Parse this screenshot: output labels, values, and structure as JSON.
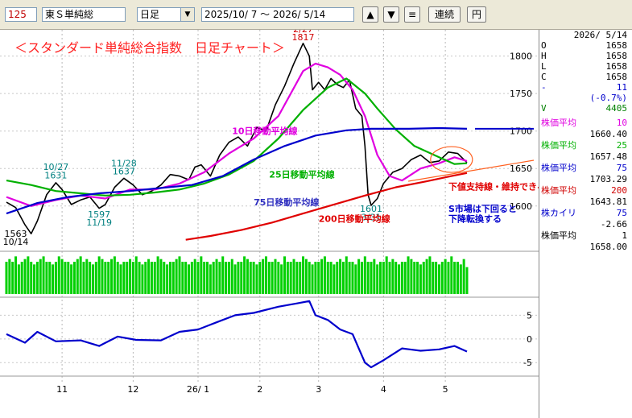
{
  "toolbar": {
    "code": "125",
    "name": "東Ｓ単純総",
    "period": "日足",
    "range": "2025/10/ 7 〜  2026/ 5/14",
    "up_icon": "triangle-up-icon",
    "down_icon": "triangle-down-icon",
    "menu_icon": "menu-icon",
    "continuous_label": "連続",
    "yen_label": "円"
  },
  "panel": {
    "date": "2026/ 5/14",
    "ohlc": [
      {
        "label": "O",
        "value": "1658"
      },
      {
        "label": "H",
        "value": "1658"
      },
      {
        "label": "L",
        "value": "1658"
      },
      {
        "label": "C",
        "value": "1658"
      }
    ],
    "change": {
      "label": "-",
      "value": "11"
    },
    "change_pct": "(-0.7%)",
    "volume": {
      "label": "V",
      "value": "4405"
    },
    "indicators": [
      {
        "label": "株価平均",
        "param": "10",
        "value": "1660.40",
        "color": "#e000e0"
      },
      {
        "label": "株価平均",
        "param": "25",
        "value": "1657.48",
        "color": "#00b000"
      },
      {
        "label": "株価平均",
        "param": "75",
        "value": "1703.29",
        "color": "#0000cc"
      },
      {
        "label": "株価平均",
        "param": "200",
        "value": "1643.81",
        "color": "#d00000"
      },
      {
        "label": "株カイリ",
        "param": "75",
        "value": "-2.66",
        "color": "#0000cc"
      },
      {
        "label": "株価平均",
        "param": "1",
        "value": "1658.00",
        "color": "#000000"
      }
    ]
  },
  "chart_data": {
    "type": "line",
    "title": "＜スタンダード単純総合指数　日足チャート＞",
    "x_ticks": [
      "11",
      "12",
      "26/ 1",
      "2",
      "3",
      "4",
      "5"
    ],
    "y_ticks": [
      1600,
      1650,
      1700,
      1750,
      1800
    ],
    "ylim": [
      1545,
      1835
    ],
    "dev_ticks": [
      5,
      0,
      -5
    ],
    "dev_lim": [
      -7,
      10
    ],
    "n_days": 150,
    "series": [
      {
        "name": "",
        "color": "#000000",
        "points": [
          [
            0,
            1605
          ],
          [
            3,
            1598
          ],
          [
            6,
            1575
          ],
          [
            8,
            1563
          ],
          [
            10,
            1580
          ],
          [
            13,
            1615
          ],
          [
            16,
            1631
          ],
          [
            18,
            1622
          ],
          [
            21,
            1602
          ],
          [
            24,
            1608
          ],
          [
            27,
            1612
          ],
          [
            30,
            1597
          ],
          [
            32,
            1602
          ],
          [
            35,
            1625
          ],
          [
            38,
            1637
          ],
          [
            41,
            1628
          ],
          [
            44,
            1615
          ],
          [
            47,
            1620
          ],
          [
            50,
            1628
          ],
          [
            53,
            1642
          ],
          [
            56,
            1640
          ],
          [
            59,
            1635
          ],
          [
            61,
            1652
          ],
          [
            63,
            1655
          ],
          [
            66,
            1640
          ],
          [
            69,
            1668
          ],
          [
            72,
            1685
          ],
          [
            75,
            1692
          ],
          [
            78,
            1680
          ],
          [
            81,
            1705
          ],
          [
            84,
            1700
          ],
          [
            87,
            1735
          ],
          [
            90,
            1760
          ],
          [
            93,
            1790
          ],
          [
            96,
            1817
          ],
          [
            98,
            1800
          ],
          [
            99,
            1755
          ],
          [
            101,
            1765
          ],
          [
            103,
            1755
          ],
          [
            105,
            1770
          ],
          [
            107,
            1762
          ],
          [
            109,
            1758
          ],
          [
            111,
            1768
          ],
          [
            113,
            1730
          ],
          [
            115,
            1720
          ],
          [
            116,
            1680
          ],
          [
            117,
            1615
          ],
          [
            118,
            1601
          ],
          [
            120,
            1610
          ],
          [
            122,
            1630
          ],
          [
            125,
            1645
          ],
          [
            128,
            1650
          ],
          [
            131,
            1662
          ],
          [
            134,
            1668
          ],
          [
            137,
            1658
          ],
          [
            140,
            1660
          ],
          [
            143,
            1672
          ],
          [
            146,
            1670
          ],
          [
            149,
            1658
          ]
        ]
      },
      {
        "name": "10日移動平均線",
        "color": "#e000e0",
        "points": [
          [
            0,
            1612
          ],
          [
            8,
            1600
          ],
          [
            16,
            1608
          ],
          [
            24,
            1614
          ],
          [
            32,
            1610
          ],
          [
            40,
            1622
          ],
          [
            48,
            1622
          ],
          [
            56,
            1630
          ],
          [
            64,
            1645
          ],
          [
            72,
            1670
          ],
          [
            80,
            1690
          ],
          [
            88,
            1720
          ],
          [
            96,
            1780
          ],
          [
            100,
            1790
          ],
          [
            104,
            1785
          ],
          [
            108,
            1775
          ],
          [
            112,
            1755
          ],
          [
            116,
            1720
          ],
          [
            120,
            1668
          ],
          [
            124,
            1640
          ],
          [
            128,
            1634
          ],
          [
            134,
            1650
          ],
          [
            140,
            1657
          ],
          [
            145,
            1665
          ],
          [
            149,
            1660
          ]
        ]
      },
      {
        "name": "25日移動平均線",
        "color": "#00b000",
        "points": [
          [
            0,
            1634
          ],
          [
            8,
            1628
          ],
          [
            16,
            1620
          ],
          [
            24,
            1617
          ],
          [
            32,
            1614
          ],
          [
            40,
            1615
          ],
          [
            48,
            1618
          ],
          [
            56,
            1622
          ],
          [
            64,
            1630
          ],
          [
            72,
            1642
          ],
          [
            80,
            1660
          ],
          [
            88,
            1690
          ],
          [
            96,
            1728
          ],
          [
            104,
            1758
          ],
          [
            110,
            1770
          ],
          [
            116,
            1750
          ],
          [
            120,
            1730
          ],
          [
            126,
            1702
          ],
          [
            132,
            1680
          ],
          [
            140,
            1665
          ],
          [
            145,
            1656
          ],
          [
            149,
            1657
          ]
        ]
      },
      {
        "name": "75日移動平均線",
        "color": "#0000cc",
        "points": [
          [
            0,
            1590
          ],
          [
            10,
            1604
          ],
          [
            20,
            1612
          ],
          [
            30,
            1617
          ],
          [
            40,
            1620
          ],
          [
            50,
            1624
          ],
          [
            60,
            1628
          ],
          [
            70,
            1640
          ],
          [
            80,
            1662
          ],
          [
            90,
            1680
          ],
          [
            100,
            1694
          ],
          [
            110,
            1701
          ],
          [
            118,
            1703
          ],
          [
            130,
            1703
          ],
          [
            140,
            1704
          ],
          [
            149,
            1703
          ]
        ]
      },
      {
        "name": "200日移動平均線",
        "color": "#e00000",
        "points": [
          [
            58,
            1555
          ],
          [
            66,
            1560
          ],
          [
            76,
            1568
          ],
          [
            86,
            1578
          ],
          [
            96,
            1590
          ],
          [
            106,
            1602
          ],
          [
            116,
            1614
          ],
          [
            126,
            1625
          ],
          [
            136,
            1633
          ],
          [
            144,
            1640
          ],
          [
            149,
            1644
          ]
        ]
      },
      {
        "name": "株カイリ 75",
        "color": "#0000cc",
        "points": [
          [
            0,
            1
          ],
          [
            6,
            -0.8
          ],
          [
            10,
            1.5
          ],
          [
            16,
            -0.5
          ],
          [
            24,
            -0.3
          ],
          [
            30,
            -1.5
          ],
          [
            36,
            0.5
          ],
          [
            42,
            -0.2
          ],
          [
            50,
            -0.3
          ],
          [
            56,
            1.5
          ],
          [
            62,
            2
          ],
          [
            68,
            3.5
          ],
          [
            74,
            5
          ],
          [
            80,
            5.5
          ],
          [
            88,
            6.8
          ],
          [
            94,
            7.5
          ],
          [
            98,
            8
          ],
          [
            100,
            5
          ],
          [
            104,
            4
          ],
          [
            108,
            2
          ],
          [
            112,
            1
          ],
          [
            114,
            -2
          ],
          [
            116,
            -5
          ],
          [
            118,
            -6
          ],
          [
            122,
            -4.5
          ],
          [
            128,
            -2
          ],
          [
            134,
            -2.5
          ],
          [
            140,
            -2.2
          ],
          [
            145,
            -1.5
          ],
          [
            149,
            -2.66
          ]
        ]
      }
    ],
    "volume": [
      6,
      6.5,
      6,
      7,
      5.5,
      6,
      6.5,
      7,
      6,
      5.5,
      6,
      6.5,
      7,
      6,
      6,
      5.5,
      6,
      7,
      6.5,
      6,
      6,
      5.5,
      6,
      6.5,
      7,
      6,
      6.5,
      6,
      5.5,
      6,
      7,
      6.5,
      6,
      6,
      6.5,
      7,
      6,
      5.5,
      6,
      6,
      6.5,
      6,
      7,
      6,
      5.5,
      6,
      6.5,
      6,
      6,
      7,
      6.5,
      6,
      5.5,
      6,
      6,
      6.5,
      7,
      6,
      6,
      5.5,
      6,
      6.5,
      6,
      7,
      6,
      6,
      5.5,
      6,
      6.5,
      6,
      7,
      6,
      6,
      6.5,
      5.5,
      6,
      6,
      7,
      6.5,
      6,
      6,
      5.5,
      6,
      6.5,
      7,
      6,
      6,
      6.5,
      6,
      5.5,
      7,
      6,
      6,
      6.5,
      6,
      6,
      7,
      6.5,
      6,
      5.5,
      6,
      6,
      6.5,
      7,
      6,
      6,
      5.5,
      6,
      6.5,
      6,
      7,
      6,
      6,
      5.5,
      6.5,
      6,
      7,
      6,
      6,
      6.5,
      5.5,
      6,
      6,
      7,
      6,
      6.5,
      6,
      5.5,
      6,
      6,
      7,
      6.5,
      6,
      6,
      5.5,
      6,
      6.5,
      7,
      6,
      6,
      5.5,
      6,
      6.5,
      6,
      7,
      6,
      6,
      5.5,
      6.5,
      5
    ],
    "annotations": [
      {
        "text": "2/27",
        "x": 96,
        "y": 1832,
        "color": "#d00000"
      },
      {
        "text": "1817",
        "x": 96,
        "y": 1821,
        "color": "#d00000"
      },
      {
        "text": "10/27",
        "x": 16,
        "y": 1648,
        "color": "#008080"
      },
      {
        "text": "1631",
        "x": 16,
        "y": 1637,
        "color": "#008080"
      },
      {
        "text": "11/28",
        "x": 38,
        "y": 1653,
        "color": "#008080"
      },
      {
        "text": "1637",
        "x": 38,
        "y": 1642,
        "color": "#008080"
      },
      {
        "text": "1597",
        "x": 30,
        "y": 1585,
        "color": "#008080"
      },
      {
        "text": "11/19",
        "x": 30,
        "y": 1574,
        "color": "#008080"
      },
      {
        "text": "1563",
        "x": 3,
        "y": 1559,
        "color": "#000000"
      },
      {
        "text": "10/14",
        "x": 3,
        "y": 1548,
        "color": "#000000"
      },
      {
        "text": "1601",
        "x": 118,
        "y": 1592,
        "color": "#008080"
      },
      {
        "text": "3/31",
        "x": 118,
        "y": 1581,
        "color": "#008080"
      },
      {
        "text": "10日移動平均線",
        "x": 73,
        "y": 1696,
        "color": "#e000e0"
      },
      {
        "text": "25日移動平均線",
        "x": 85,
        "y": 1638,
        "color": "#00b000"
      },
      {
        "text": "75日移動平均線",
        "x": 80,
        "y": 1601,
        "color": "#3030c0"
      },
      {
        "text": "200日移動平均線",
        "x": 101,
        "y": 1579,
        "color": "#e00000"
      },
      {
        "text": "下値支持線・維持できるか",
        "x": 143,
        "y": 1622,
        "color": "#e00000"
      },
      {
        "text": "S市場は下回ると",
        "x": 143,
        "y": 1592,
        "color": "#0000cc"
      },
      {
        "text": "下降転換する",
        "x": 143,
        "y": 1579,
        "color": "#0000cc"
      }
    ]
  }
}
